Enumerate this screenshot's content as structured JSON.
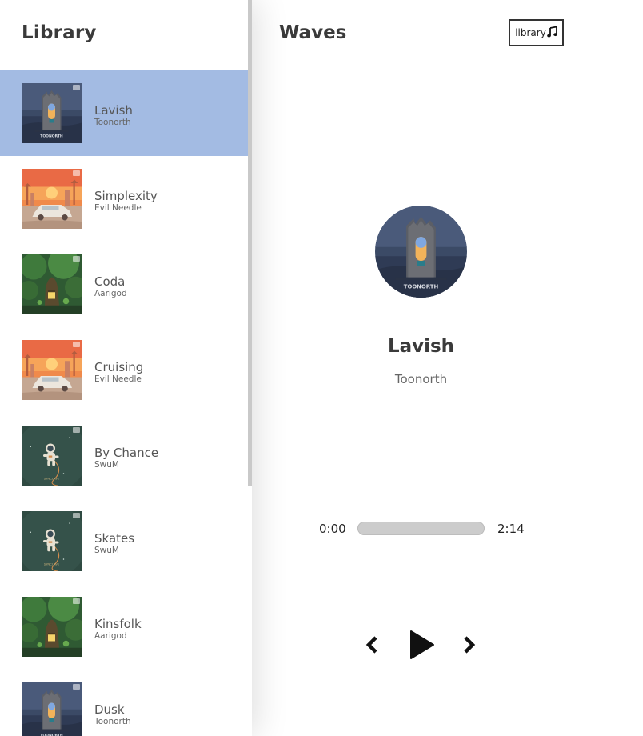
{
  "library": {
    "title": "Library",
    "songs": [
      {
        "name": "Lavish",
        "artist": "Toonorth",
        "active": true,
        "cover": "castle"
      },
      {
        "name": "Simplexity",
        "artist": "Evil Needle",
        "active": false,
        "cover": "sunset"
      },
      {
        "name": "Coda",
        "artist": "Aarigod",
        "active": false,
        "cover": "forest"
      },
      {
        "name": "Cruising",
        "artist": "Evil Needle",
        "active": false,
        "cover": "sunset"
      },
      {
        "name": "By Chance",
        "artist": "SwuM",
        "active": false,
        "cover": "astronaut"
      },
      {
        "name": "Skates",
        "artist": "SwuM",
        "active": false,
        "cover": "astronaut"
      },
      {
        "name": "Kinsfolk",
        "artist": "Aarigod",
        "active": false,
        "cover": "forest"
      },
      {
        "name": "Dusk",
        "artist": "Toonorth",
        "active": false,
        "cover": "castle"
      }
    ]
  },
  "nav": {
    "brand": "Waves",
    "library_button": "library",
    "music_icon": "music-note-icon"
  },
  "player": {
    "song_name": "Lavish",
    "artist": "Toonorth",
    "current_time": "0:00",
    "duration": "2:14",
    "progress_fraction": 0,
    "icons": {
      "prev": "chevron-left-icon",
      "play": "play-icon",
      "next": "chevron-right-icon"
    }
  },
  "colors": {
    "active_item": "#a3bbe3",
    "progress_track": "#cccccc",
    "text_dark": "#3a3a3a"
  }
}
